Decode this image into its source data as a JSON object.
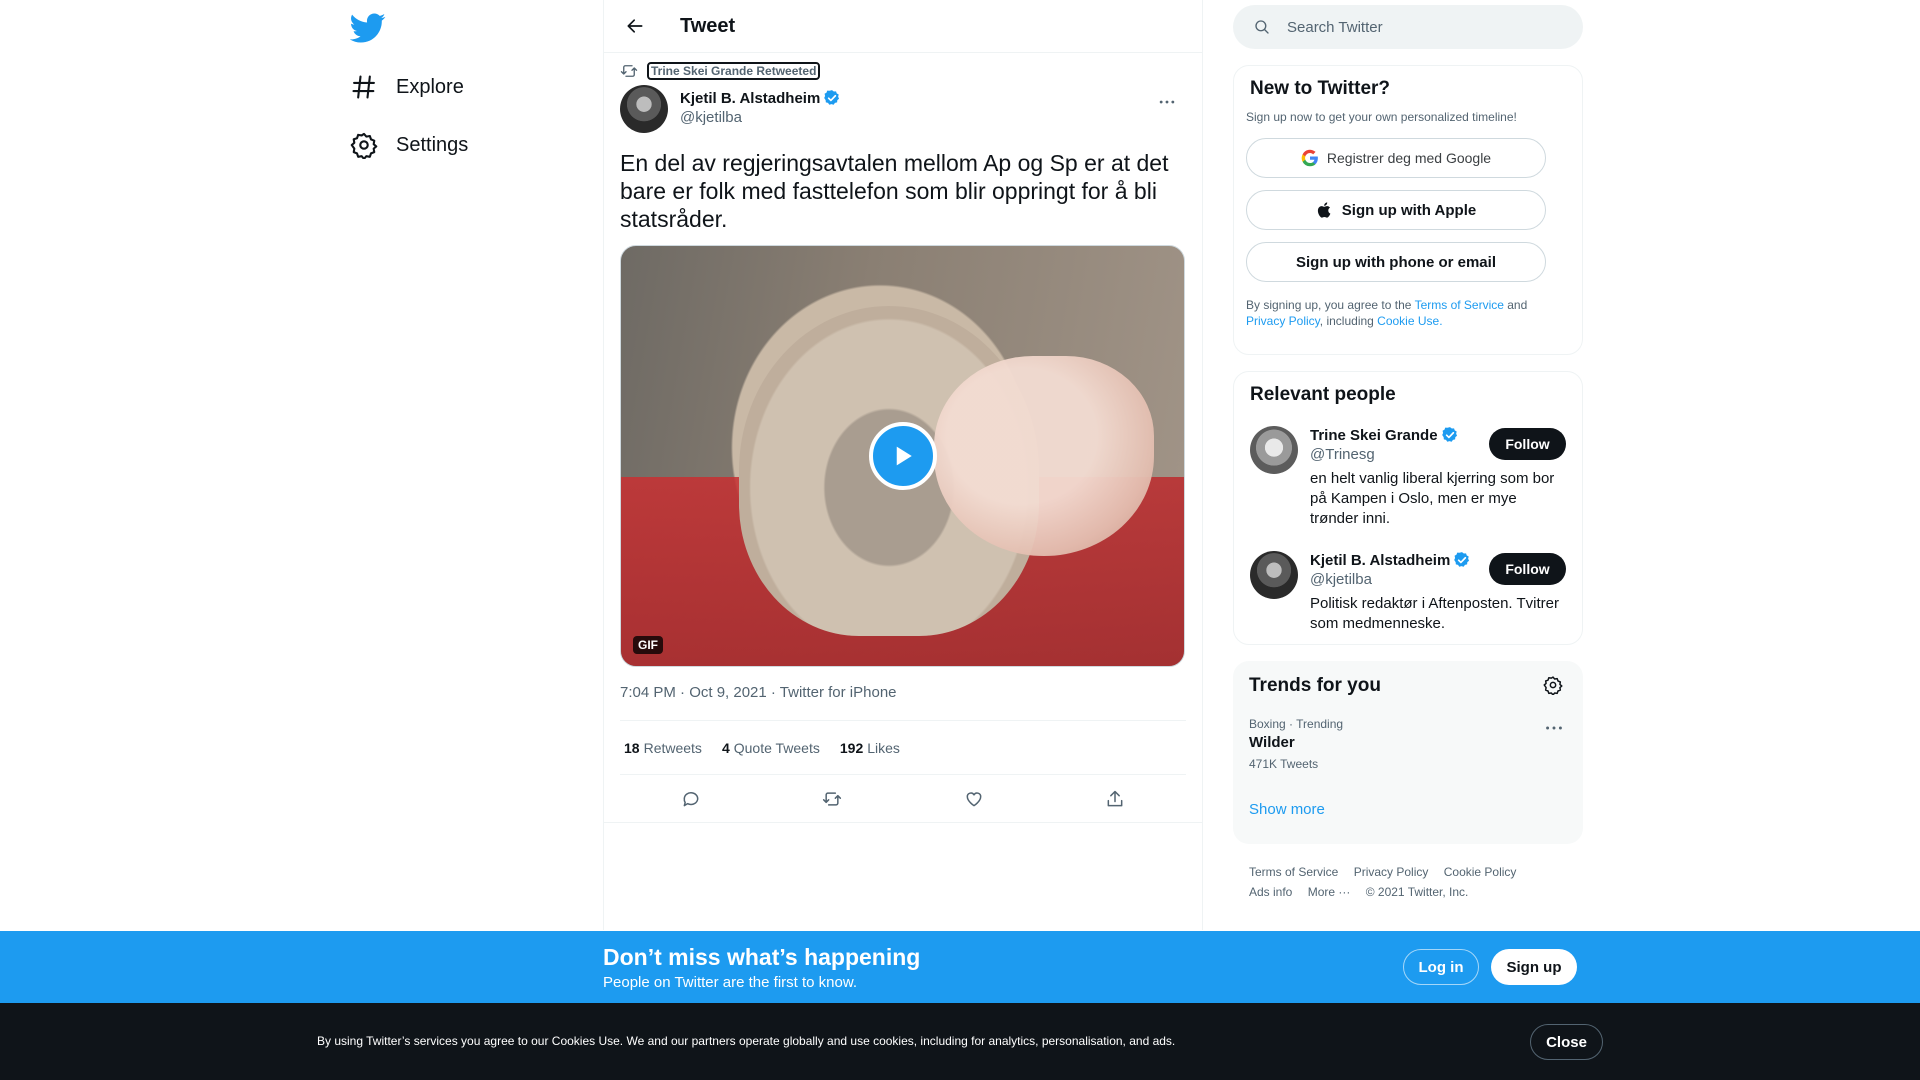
{
  "nav": {
    "logo_icon": "twitter-bird-icon",
    "items": [
      {
        "label": "Explore",
        "icon": "hashtag-icon"
      },
      {
        "label": "Settings",
        "icon": "gear-icon"
      }
    ]
  },
  "header": {
    "title": "Tweet",
    "back_icon": "arrow-left-icon"
  },
  "tweet": {
    "retweeted_by": "Trine Skei Grande Retweeted",
    "author": {
      "name": "Kjetil B. Alstadheim",
      "handle": "@kjetilba",
      "verified": true
    },
    "text": "En del av regjeringsavtalen mellom Ap og Sp er at det bare er folk med fasttelefon som blir oppringt for å bli statsråder.",
    "media": {
      "badge": "GIF"
    },
    "timestamp": "7:04 PM · Oct 9, 2021 · Twitter for iPhone",
    "stats": [
      {
        "count": "18",
        "label": "Retweets"
      },
      {
        "count": "4",
        "label": "Quote Tweets"
      },
      {
        "count": "192",
        "label": "Likes"
      }
    ]
  },
  "search": {
    "placeholder": "Search Twitter"
  },
  "new_to_twitter": {
    "title": "New to Twitter?",
    "subtitle": "Sign up now to get your own personalized timeline!",
    "google_label": "Registrer deg med Google",
    "apple_label": "Sign up with Apple",
    "phone_label": "Sign up with phone or email",
    "legal": {
      "p1": "By signing up, you agree to the ",
      "tos": "Terms of Service",
      "p2": " and ",
      "privacy": "Privacy Policy",
      "p3": ", including ",
      "cookie": "Cookie Use."
    }
  },
  "relevant": {
    "title": "Relevant people",
    "people": [
      {
        "name": "Trine Skei Grande",
        "handle": "@Trinesg",
        "bio": "en helt vanlig liberal kjerring som bor på Kampen i Oslo, men er mye trønder inni.",
        "follow": "Follow"
      },
      {
        "name": "Kjetil B. Alstadheim",
        "handle": "@kjetilba",
        "bio": "Politisk redaktør i Aftenposten. Tvitrer som medmenneske.",
        "follow": "Follow"
      }
    ]
  },
  "trends": {
    "title": "Trends for you",
    "items": [
      {
        "meta": "Boxing · Trending",
        "name": "Wilder",
        "count": "471K Tweets"
      }
    ],
    "show_more": "Show more"
  },
  "footer": {
    "links": [
      "Terms of Service",
      "Privacy Policy",
      "Cookie Policy",
      "Ads info",
      "More ···"
    ],
    "copyright": "© 2021 Twitter, Inc."
  },
  "signup_bar": {
    "title": "Don’t miss what’s happening",
    "subtitle": "People on Twitter are the first to know.",
    "login": "Log in",
    "signup": "Sign up"
  },
  "cookie_bar": {
    "text": "By using Twitter’s services you agree to our Cookies Use. We and our partners operate globally and use cookies, including for analytics, personalisation, and ads.",
    "close": "Close"
  },
  "colors": {
    "accent": "#1d9bf0",
    "text": "#0f1419",
    "muted": "#536471"
  }
}
